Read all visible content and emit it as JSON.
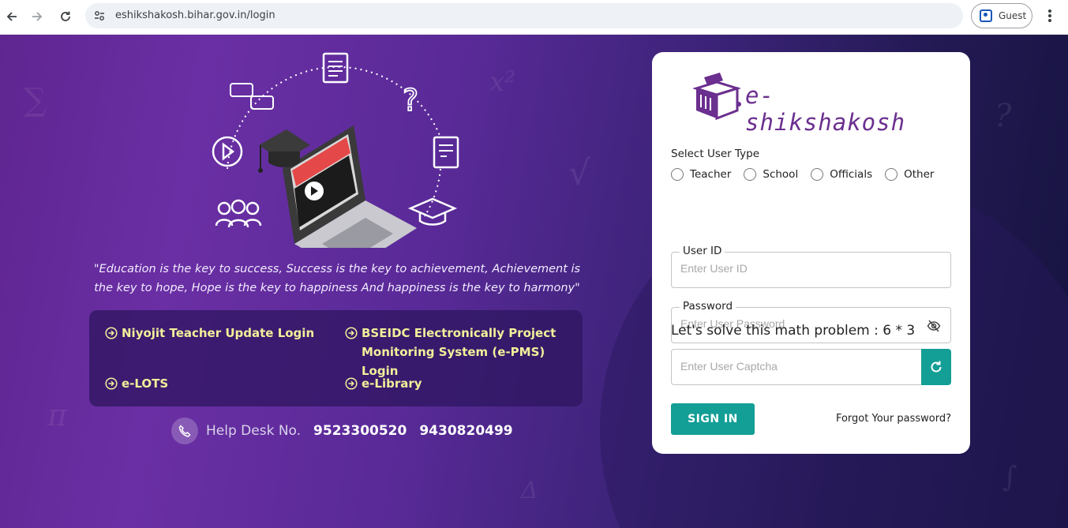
{
  "browser": {
    "url": "eshikshakosh.bihar.gov.in/login",
    "profile_label": "Guest"
  },
  "quote": "\"Education is the key to success, Success is the key to achievement, Achievement is the key to hope, Hope is the key to happiness And happiness is the key to harmony\"",
  "links": [
    {
      "label": "Niyojit Teacher Update Login"
    },
    {
      "label": "BSEIDC Electronically Project Monitoring System (e-PMS) Login"
    },
    {
      "label": "e-LOTS"
    },
    {
      "label": "e-Library"
    }
  ],
  "helpdesk": {
    "label": "Help Desk No.",
    "numbers": [
      "9523300520",
      "9430820499"
    ]
  },
  "login": {
    "logo_text": "e-shikshakosh",
    "user_type_title": "Select User Type",
    "user_types": [
      "Teacher",
      "School",
      "Officials",
      "Other"
    ],
    "user_id_label": "User ID",
    "user_id_placeholder": "Enter User ID",
    "password_label": "Password",
    "password_placeholder": "Enter User Password",
    "math_prompt": "Let's solve this math problem : 6 * 3",
    "captcha_placeholder": "Enter User Captcha",
    "signin_label": "SIGN IN",
    "forgot_label": "Forgot Your password?"
  },
  "colors": {
    "accent": "#139e96",
    "brand": "#6b2f8f",
    "link": "#f1ef9a"
  }
}
